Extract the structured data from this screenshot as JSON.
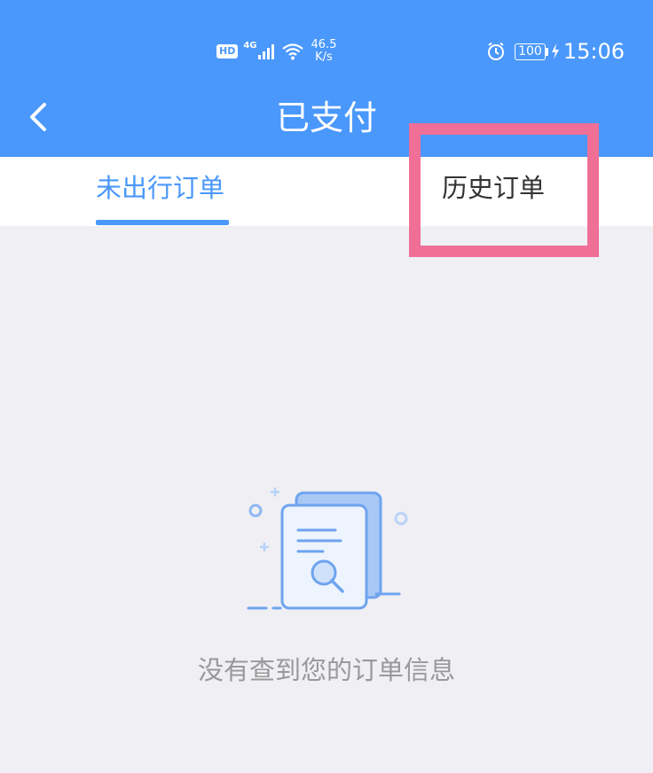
{
  "status_bar": {
    "hd_badge": "HD",
    "network_gen": "4G",
    "net_speed_value": "46.5",
    "net_speed_unit": "K/s",
    "battery_level": "100",
    "time": "15:06",
    "icons": [
      "signal-icon",
      "wifi-icon",
      "alarm-icon",
      "battery-icon",
      "charging-icon"
    ]
  },
  "header": {
    "title": "已支付",
    "back_icon": "chevron-left-icon",
    "background_color": "#4a98fb"
  },
  "tabs": [
    {
      "label": "未出行订单",
      "active": true
    },
    {
      "label": "历史订单",
      "active": false
    }
  ],
  "empty_state": {
    "icon": "document-search-icon",
    "message": "没有查到您的订单信息"
  },
  "colors": {
    "accent": "#4a98fb",
    "highlight": "#ef6f96",
    "background": "#efeff4"
  }
}
